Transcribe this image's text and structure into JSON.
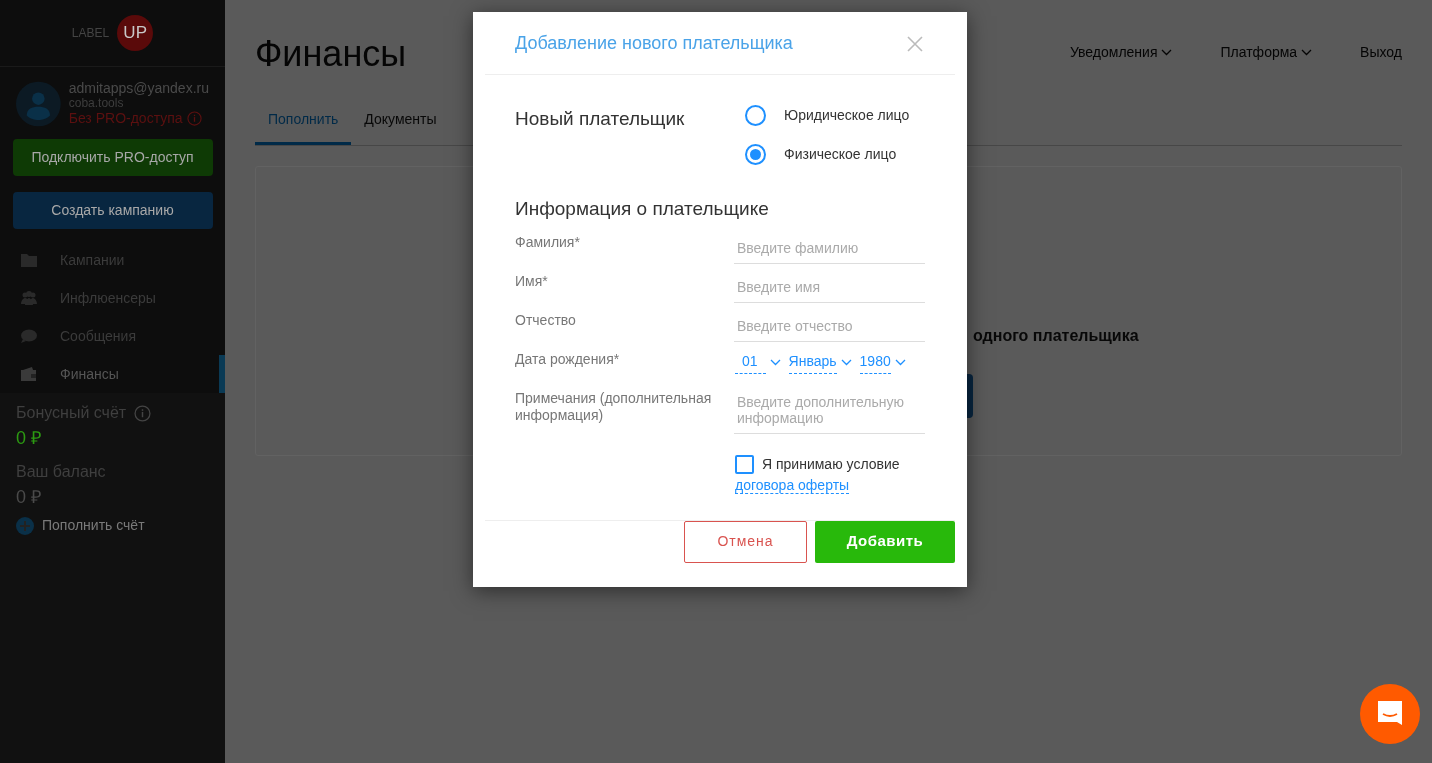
{
  "sidebar": {
    "logo": {
      "text": "LABEL",
      "badge": "UP"
    },
    "user": {
      "email": "admitapps@yandex.ru",
      "site": "coba.tools",
      "status": "Без PRO-доступа"
    },
    "buttons": [
      {
        "kind": "pro",
        "label": "Подключить PRO-доступ"
      },
      {
        "kind": "create",
        "label": "Создать кампанию"
      }
    ],
    "nav": [
      {
        "kind": "folder",
        "label": "Кампании",
        "selected": false
      },
      {
        "kind": "people",
        "label": "Инфлюенсеры",
        "selected": false
      },
      {
        "kind": "chat",
        "label": "Сообщения",
        "selected": false
      },
      {
        "kind": "wallet",
        "label": "Финансы",
        "selected": true
      }
    ],
    "bonus": {
      "label": "Бонусный счёт",
      "value": "0 ₽"
    },
    "balance": {
      "label": "Ваш баланс",
      "value": "0 ₽"
    },
    "top_up": "Пополнить счёт"
  },
  "header": {
    "title": "Финансы",
    "menu": [
      {
        "label": "Уведомления",
        "dropdown": true
      },
      {
        "label": "Платформа",
        "dropdown": true
      },
      {
        "label": "Выход",
        "dropdown": false
      }
    ]
  },
  "tabs": [
    {
      "label": "Пополнить",
      "selected": true
    },
    {
      "label": "Документы",
      "selected": false
    }
  ],
  "panel": {
    "text": "одного плательщика"
  },
  "modal": {
    "title": "Добавление нового плательщика",
    "payer_heading": "Новый плательщик",
    "payer_types": [
      {
        "label": "Юридическое лицо",
        "selected": false
      },
      {
        "label": "Физическое лицо",
        "selected": true
      }
    ],
    "info_heading": "Информация о плательщике",
    "fields": [
      {
        "kind": "text",
        "label": "Фамилия*",
        "placeholder": "Введите фамилию"
      },
      {
        "kind": "text",
        "label": "Имя*",
        "placeholder": "Введите имя"
      },
      {
        "kind": "text",
        "label": "Отчество",
        "placeholder": "Введите отчество"
      },
      {
        "kind": "date",
        "label": "Дата рождения*",
        "day": "01",
        "month": "Январь",
        "year": "1980"
      },
      {
        "kind": "textarea",
        "label": "Примечания (дополнительная информация)",
        "placeholder": "Введите дополнительную информацию"
      }
    ],
    "agreement": {
      "text": "Я принимаю условие",
      "link": "договора оферты",
      "checked": false
    },
    "buttons": [
      {
        "kind": "cancel",
        "label": "Отмена"
      },
      {
        "kind": "submit",
        "label": "Добавить"
      }
    ]
  }
}
